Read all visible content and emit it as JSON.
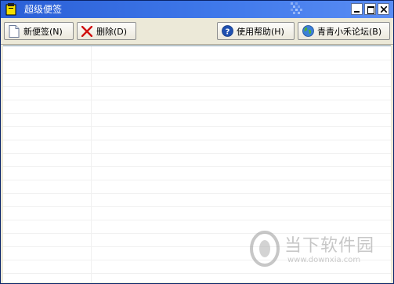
{
  "window": {
    "title": "超级便签"
  },
  "toolbar": {
    "new_note": "新便签(N)",
    "delete": "删除(D)",
    "help": "使用帮助(H)",
    "forum": "青青小禾论坛(B)"
  },
  "icons": {
    "app": "note-app-icon",
    "new_note": "document-icon",
    "delete": "red-x-icon",
    "help": "question-icon",
    "forum": "globe-icon"
  },
  "watermark": {
    "name": "当下软件园",
    "url": "www.downxia.com"
  },
  "colors": {
    "titlebar": "#2a5fd6",
    "toolbar_bg": "#ece9d8",
    "delete_x": "#d01010",
    "help_icon": "#2050b0"
  }
}
